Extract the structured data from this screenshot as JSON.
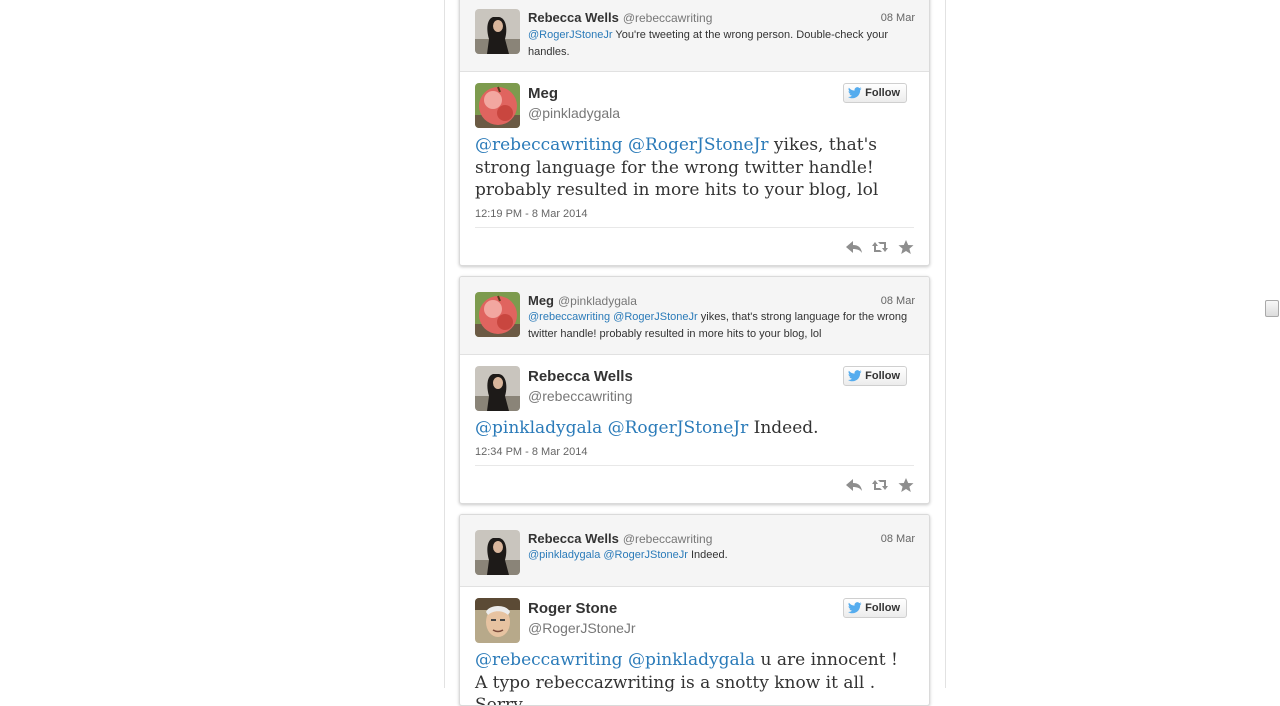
{
  "cards": [
    {
      "parent": {
        "name": "Rebecca Wells",
        "handle": "@rebeccawriting",
        "date": "08 Mar",
        "mentions": [
          "@RogerJStoneJr"
        ],
        "text": " You're tweeting at the wrong person. Double-check your handles."
      },
      "tweet": {
        "name": "Meg",
        "handle": "@pinkladygala",
        "follow_label": "Follow",
        "mentions": [
          "@rebeccawriting",
          "@RogerJStoneJr"
        ],
        "text": " yikes, that's strong language for the wrong twitter handle!  probably resulted in more hits to your blog, lol",
        "time": "12:19 PM - 8 Mar 2014"
      }
    },
    {
      "parent": {
        "name": "Meg",
        "handle": "@pinkladygala",
        "date": "08 Mar",
        "mentions": [
          "@rebeccawriting",
          "@RogerJStoneJr"
        ],
        "text": " yikes, that's strong language for the wrong twitter handle!  probably resulted in more hits to your blog, lol"
      },
      "tweet": {
        "name": "Rebecca Wells",
        "handle": "@rebeccawriting",
        "follow_label": "Follow",
        "mentions": [
          "@pinkladygala",
          "@RogerJStoneJr"
        ],
        "text": " Indeed.",
        "time": "12:34 PM - 8 Mar 2014"
      }
    },
    {
      "parent": {
        "name": "Rebecca Wells",
        "handle": "@rebeccawriting",
        "date": "08 Mar",
        "mentions": [
          "@pinkladygala",
          "@RogerJStoneJr"
        ],
        "text": " Indeed."
      },
      "tweet": {
        "name": "Roger Stone",
        "handle": "@RogerJStoneJr",
        "follow_label": "Follow",
        "mentions": [
          "@rebeccawriting",
          "@pinkladygala"
        ],
        "text": " u are innocent ! A typo rebeccazwriting is a snotty know it all . Sorry"
      }
    }
  ],
  "icons": {
    "reply": "reply-icon",
    "retweet": "retweet-icon",
    "favorite": "star-icon",
    "follow": "twitter-bird-icon"
  },
  "colors": {
    "link": "#2b7bb9",
    "twitter_blue": "#55acee",
    "parent_bg": "#f5f5f5"
  }
}
